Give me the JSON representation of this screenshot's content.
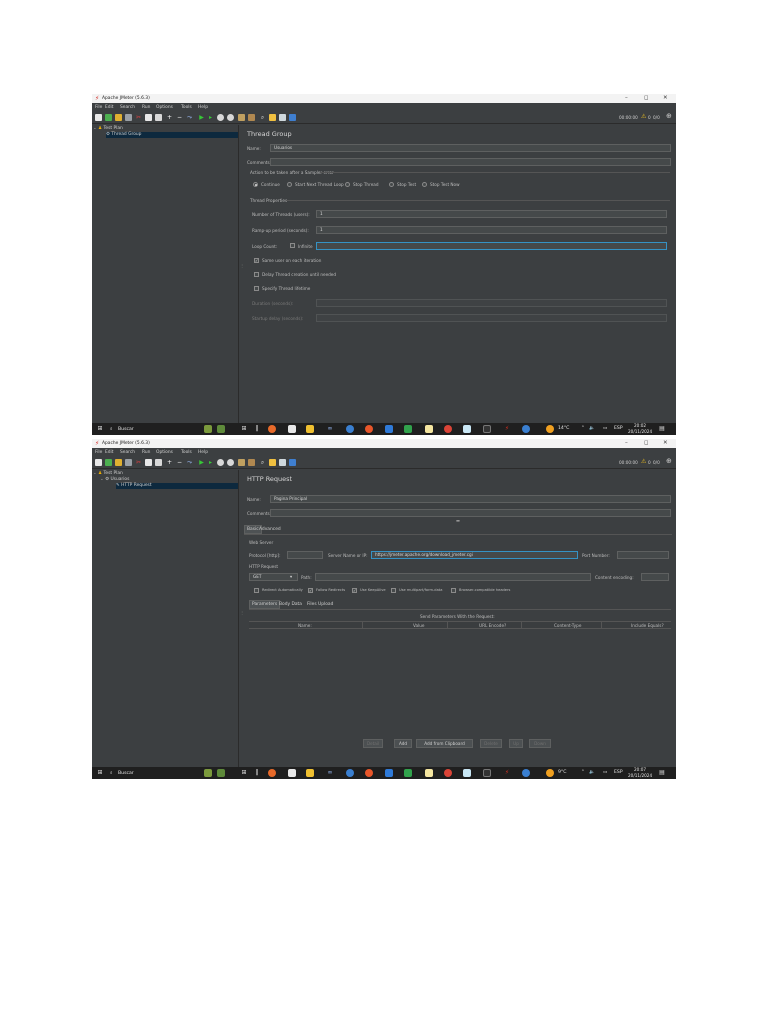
{
  "shots": [
    {
      "window": {
        "title": "Apache JMeter (5.6.3)",
        "minimize": "–",
        "maximize": "◻",
        "close": "✕"
      },
      "menu": [
        "File",
        "Edit",
        "Search",
        "Run",
        "Options",
        "Tools",
        "Help"
      ],
      "toolbar_status": {
        "elapsed": "00:00:00",
        "warning_count": "0",
        "threads": "0/0"
      },
      "tree": [
        {
          "label": "Test Plan",
          "icon": "test-plan-icon"
        },
        {
          "label": "Thread Group",
          "icon": "thread-group-icon",
          "selected": true
        }
      ],
      "panel": {
        "title": "Thread Group",
        "name_label": "Name:",
        "name_value": "Usuarios",
        "comments_label": "Comments:",
        "comments_value": "",
        "action_title": "Action to be taken after a Sampler error",
        "actions": [
          {
            "label": "Continue",
            "selected": true
          },
          {
            "label": "Start Next Thread Loop",
            "selected": false
          },
          {
            "label": "Stop Thread",
            "selected": false
          },
          {
            "label": "Stop Test",
            "selected": false
          },
          {
            "label": "Stop Test Now",
            "selected": false
          }
        ],
        "props_title": "Thread Properties",
        "threads_label": "Number of Threads (users):",
        "threads_value": "1",
        "rampup_label": "Ramp-up period (seconds):",
        "rampup_value": "1",
        "loop_label": "Loop Count:",
        "infinite_label": "Infinite",
        "loop_value": "",
        "same_user_label": "Same user on each iteration",
        "delay_label": "Delay Thread creation until needed",
        "lifetime_label": "Specify Thread lifetime",
        "duration_label": "Duration (seconds):",
        "startup_label": "Startup delay (seconds):"
      },
      "taskbar": {
        "search": "Buscar",
        "weather": "14°C",
        "lang": "ESP",
        "time": "20:02",
        "date": "20/11/2024"
      }
    },
    {
      "window": {
        "title": "Apache JMeter (5.6.3)",
        "minimize": "–",
        "maximize": "◻",
        "close": "✕"
      },
      "menu": [
        "File",
        "Edit",
        "Search",
        "Run",
        "Options",
        "Tools",
        "Help"
      ],
      "toolbar_status": {
        "elapsed": "00:00:00",
        "warning_count": "0",
        "threads": "0/0"
      },
      "tree": [
        {
          "label": "Test Plan",
          "icon": "test-plan-icon"
        },
        {
          "label": "Usuarios",
          "icon": "thread-group-icon"
        },
        {
          "label": "HTTP Request",
          "icon": "http-request-icon",
          "selected": true
        }
      ],
      "panel": {
        "title": "HTTP Request",
        "name_label": "Name:",
        "name_value": "Pagina Principal",
        "comments_label": "Comments:",
        "comments_value": "",
        "tabs": [
          "Basic",
          "Advanced"
        ],
        "web_server_title": "Web Server",
        "protocol_label": "Protocol [http]:",
        "protocol_value": "",
        "server_label": "Server Name or IP:",
        "server_value": "https://jmeter.apache.org/download_jmeter.cgi",
        "port_label": "Port Number:",
        "port_value": "",
        "http_request_title": "HTTP Request",
        "method": "GET",
        "path_label": "Path:",
        "path_value": "",
        "encoding_label": "Content encoding:",
        "encoding_value": "",
        "options": [
          {
            "label": "Redirect Automatically",
            "checked": false
          },
          {
            "label": "Follow Redirects",
            "checked": true
          },
          {
            "label": "Use KeepAlive",
            "checked": true
          },
          {
            "label": "Use multipart/form-data",
            "checked": false
          },
          {
            "label": "Browser-compatible headers",
            "checked": false
          }
        ],
        "subtabs": [
          "Parameters",
          "Body Data",
          "Files Upload"
        ],
        "params_caption": "Send Parameters With the Request:",
        "columns": [
          "Name:",
          "Value",
          "URL Encode?",
          "Content-Type",
          "Include Equals?"
        ],
        "buttons": [
          {
            "label": "Detail",
            "enabled": false
          },
          {
            "label": "Add",
            "enabled": true
          },
          {
            "label": "Add from Clipboard",
            "enabled": true
          },
          {
            "label": "Delete",
            "enabled": false
          },
          {
            "label": "Up",
            "enabled": false
          },
          {
            "label": "Down",
            "enabled": false
          }
        ]
      },
      "taskbar": {
        "search": "Buscar",
        "weather": "9°C",
        "lang": "ESP",
        "time": "20:07",
        "date": "20/11/2024"
      }
    }
  ]
}
